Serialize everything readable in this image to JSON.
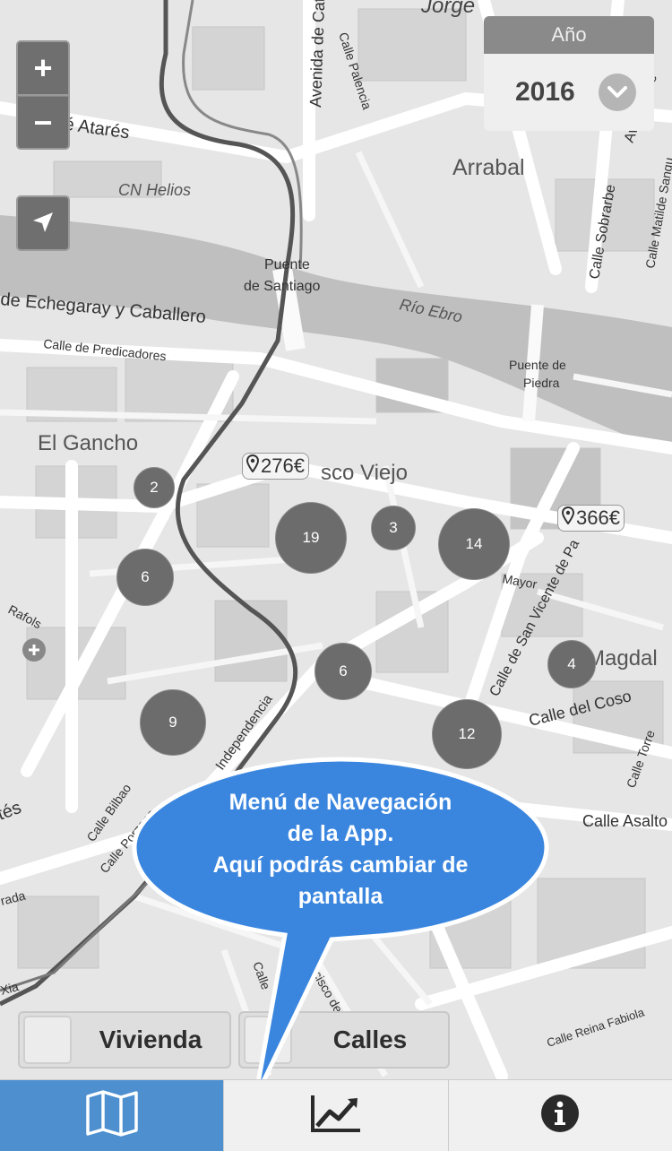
{
  "map": {
    "labels": {
      "jorge": "Jorge",
      "avenida_de_cataluna": "Avenida de Cataluña",
      "calle_palencia": "Calle Palencia",
      "jose_atares": "José Atarés",
      "cn_helios": "CN Helios",
      "arrabal": "Arrabal",
      "calle_sobrarbe": "Calle Sobrarbe",
      "avenida_de_cataluna2": "Avenida de",
      "calle_matilde_sangu": "Calle Matilde Sangu",
      "puente_de_santiago_1": "Puente",
      "puente_de_santiago_2": "de Santiago",
      "echegaray": "de Echegaray y Caballero",
      "rio_ebro": "Río Ebro",
      "calle_predicadores": "Calle de Predicadores",
      "puente_piedra_1": "Puente de",
      "puente_piedra_2": "Piedra",
      "el_gancho": "El Gancho",
      "casco_viejo": "sco Viejo",
      "mayor": "Mayor",
      "calle_san_vicente": "Calle de San Vicente de Pa",
      "magdal": "Magdal",
      "calle_del_coso": "Calle del Coso",
      "rafols": "Rafols",
      "independencia": "Independencia",
      "calle_bilbao": "Calle Bilbao",
      "calle_porzano": "Calle Porzano",
      "calle_torre": "Calle Torre",
      "calle_asalto": "Calle Asalto",
      "calle_reina_fabiola": "Calle Reina Fabiola",
      "calle_francisco": "ncisco de",
      "calle_vertical": "Calle",
      "rada": "rada",
      "tes": "tés",
      "xia": "Xia"
    },
    "clusters": [
      "2",
      "19",
      "3",
      "14",
      "6",
      "6",
      "4",
      "9",
      "12"
    ],
    "prices": [
      "276€",
      "366€"
    ]
  },
  "controls": {
    "zoom_in": "+",
    "zoom_out": "−"
  },
  "year_selector": {
    "label": "Año",
    "value": "2016"
  },
  "layers": {
    "vivienda": "Vivienda",
    "calles": "Calles"
  },
  "tooltip": {
    "line1": "Menú de Navegación",
    "line2": "de la App.",
    "line3": "Aquí podrás cambiar de",
    "line4": "pantalla"
  },
  "tabs": {
    "icons": [
      "map-icon",
      "chart-line-icon",
      "info-icon"
    ],
    "active_color": "#4d8fcf"
  }
}
